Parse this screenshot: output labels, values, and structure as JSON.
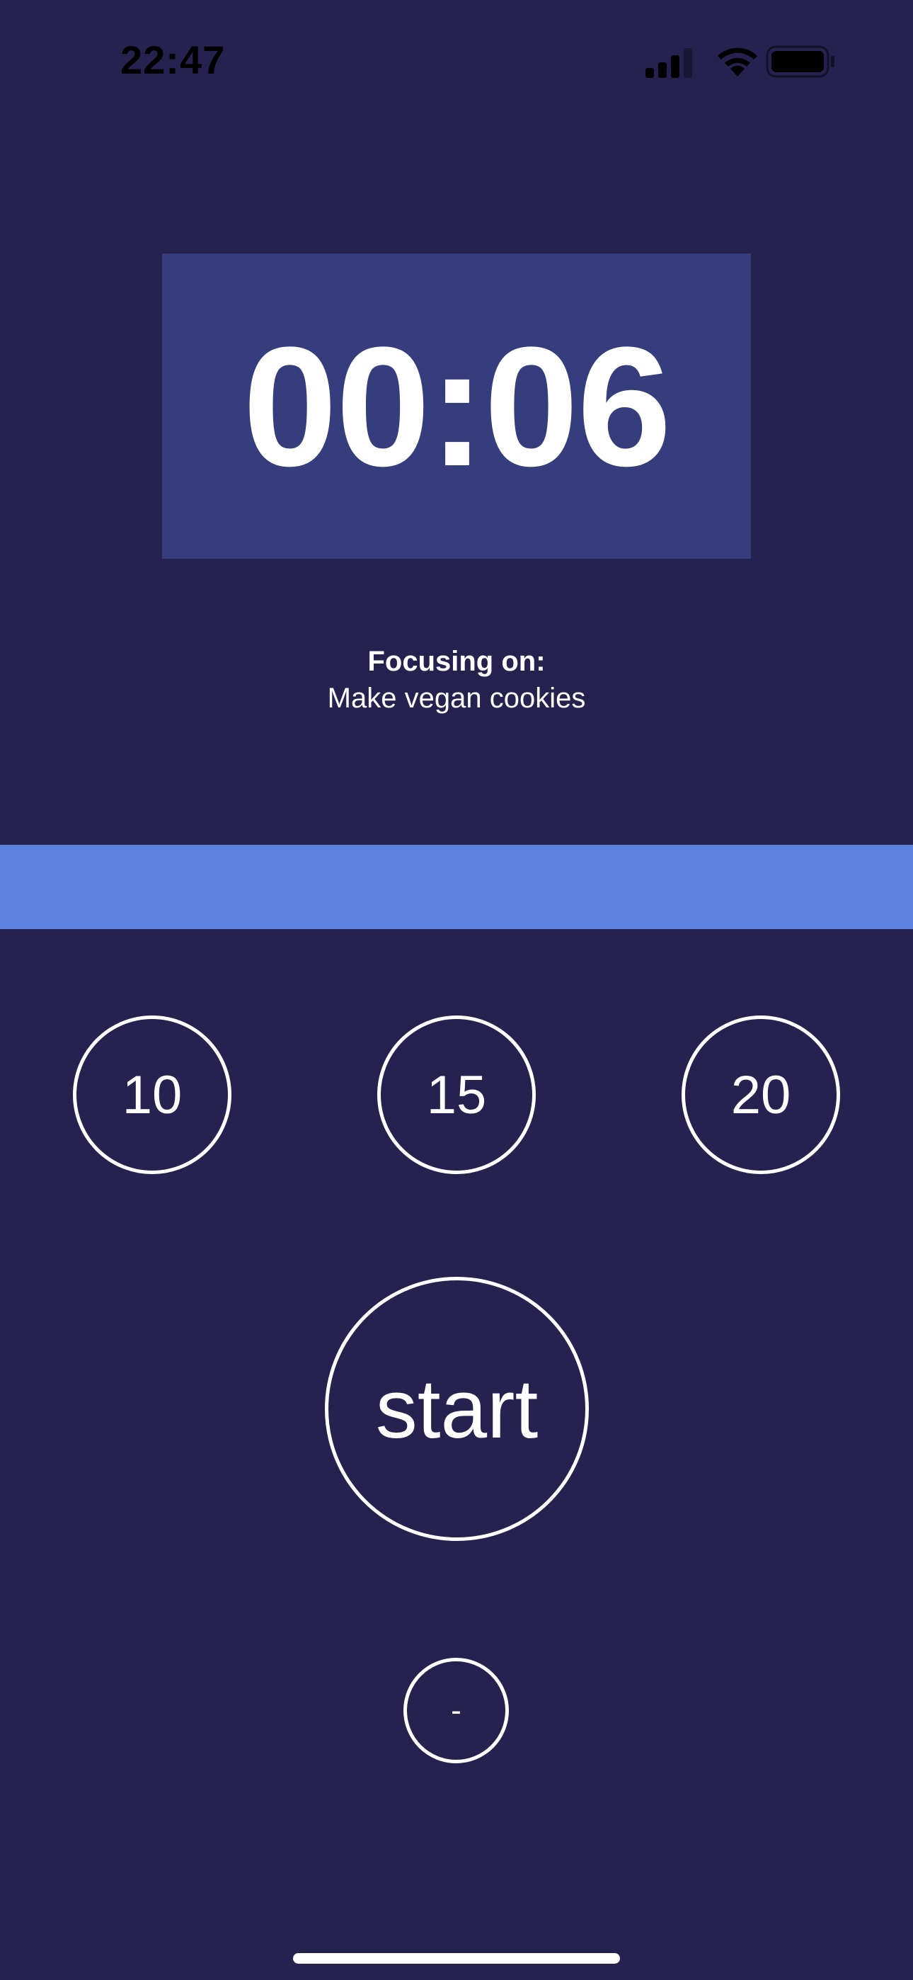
{
  "status_bar": {
    "time": "22:47",
    "icons": [
      "signal-icon",
      "wifi-icon",
      "battery-icon"
    ]
  },
  "timer": {
    "display": "00:06"
  },
  "focus": {
    "label": "Focusing on:",
    "task": "Make vegan cookies"
  },
  "progress": {
    "fraction": 1.0
  },
  "presets": [
    {
      "label": "10"
    },
    {
      "label": "15"
    },
    {
      "label": "20"
    }
  ],
  "controls": {
    "start_label": "start",
    "minus_label": "-"
  },
  "colors": {
    "background": "#25224f",
    "timer_panel": "#363d7c",
    "progress_fill": "#5b82e0",
    "foreground": "#ffffff"
  }
}
